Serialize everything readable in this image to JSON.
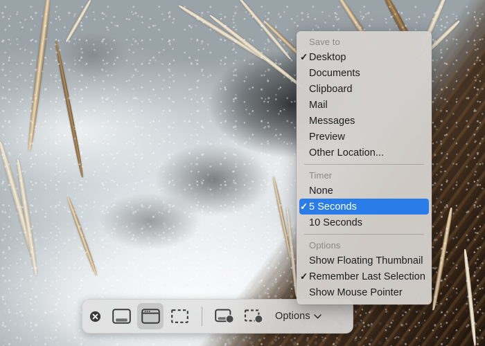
{
  "desktop": {
    "wallpaper_description": "frozen ice and snow with dried reed stalks and dark wood",
    "wallpaper_colors": {
      "snow": "#eef2f4",
      "ice_shadow": "#2a2d2f",
      "wood": "#3e2918",
      "reed": "#cdb188"
    }
  },
  "capture_toolbar": {
    "name": "Screenshot toolbar",
    "close_label": "Close",
    "tools": [
      {
        "id": "capture-entire-screen",
        "label": "Capture Entire Screen",
        "selected": false
      },
      {
        "id": "capture-selected-window",
        "label": "Capture Selected Window",
        "selected": true
      },
      {
        "id": "capture-selected-portion",
        "label": "Capture Selected Portion",
        "selected": false
      },
      {
        "id": "record-entire-screen",
        "label": "Record Entire Screen",
        "selected": false
      },
      {
        "id": "record-selected-portion",
        "label": "Record Selected Portion",
        "selected": false
      }
    ],
    "options_button": {
      "label": "Options",
      "chevron": "chevron-down-icon",
      "expanded": true
    }
  },
  "options_menu": {
    "accent_color": "#2a7de8",
    "background_color": "#d6d2cf",
    "sections": [
      {
        "id": "save-to",
        "title": "Save to",
        "items": [
          {
            "label": "Desktop",
            "checked": true,
            "highlighted": false
          },
          {
            "label": "Documents",
            "checked": false,
            "highlighted": false
          },
          {
            "label": "Clipboard",
            "checked": false,
            "highlighted": false
          },
          {
            "label": "Mail",
            "checked": false,
            "highlighted": false
          },
          {
            "label": "Messages",
            "checked": false,
            "highlighted": false
          },
          {
            "label": "Preview",
            "checked": false,
            "highlighted": false
          },
          {
            "label": "Other Location...",
            "checked": false,
            "highlighted": false
          }
        ]
      },
      {
        "id": "timer",
        "title": "Timer",
        "items": [
          {
            "label": "None",
            "checked": false,
            "highlighted": false
          },
          {
            "label": "5 Seconds",
            "checked": true,
            "highlighted": true
          },
          {
            "label": "10 Seconds",
            "checked": false,
            "highlighted": false
          }
        ]
      },
      {
        "id": "options",
        "title": "Options",
        "items": [
          {
            "label": "Show Floating Thumbnail",
            "checked": false,
            "highlighted": false
          },
          {
            "label": "Remember Last Selection",
            "checked": true,
            "highlighted": false
          },
          {
            "label": "Show Mouse Pointer",
            "checked": false,
            "highlighted": false
          }
        ]
      }
    ],
    "checkmark_glyph": "✓"
  }
}
